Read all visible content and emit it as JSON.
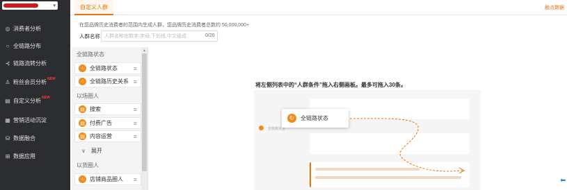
{
  "nav": {
    "items": [
      {
        "icon": "◎",
        "label": "消费者分析",
        "new": ""
      },
      {
        "icon": "○",
        "label": "全链路分布",
        "new": ""
      },
      {
        "icon": "⊰",
        "label": "链路流转分析",
        "new": ""
      },
      {
        "icon": "♙",
        "label": "粉丝会员分析",
        "new": "NEW"
      },
      {
        "icon": "▤",
        "label": "自定义分析",
        "new": "NEW"
      },
      {
        "icon": "▦",
        "label": "营销活动沉淀",
        "new": ""
      },
      {
        "icon": "⛁",
        "label": "数据融合",
        "new": ""
      },
      {
        "icon": "⊞",
        "label": "数据应用",
        "new": ""
      }
    ]
  },
  "header": {
    "active_tab": "自定义人群",
    "right_link": "触点数据"
  },
  "form": {
    "hint": "在您品牌历史消费者的范围内生成人群，您品牌历史消费者总数约 50,000,000+",
    "name_label": "人群名称",
    "name_placeholder": "人群名称由数字,字母,下划线,中文组成",
    "name_count": "0/20"
  },
  "panel": {
    "group1": "全链路状态",
    "cond1": "全链路状态",
    "cond2": "全链路历史关系",
    "group2": "以场圈人",
    "cond3": "搜索",
    "cond4": "付费广告",
    "cond5": "内容运营",
    "expand": "展开",
    "group3": "以货圈人",
    "cond6": "店铺商品圈人"
  },
  "empty": {
    "text": "将左侧列表中的“人群条件”拖入右侧画板。最多可拖入30条。",
    "floating_label": "全链路状态",
    "mini_label": "全链路状态"
  },
  "colors": {
    "accent": "#e8740c",
    "nav_bg": "#2b2d30",
    "brand_red": "#d0181f"
  }
}
